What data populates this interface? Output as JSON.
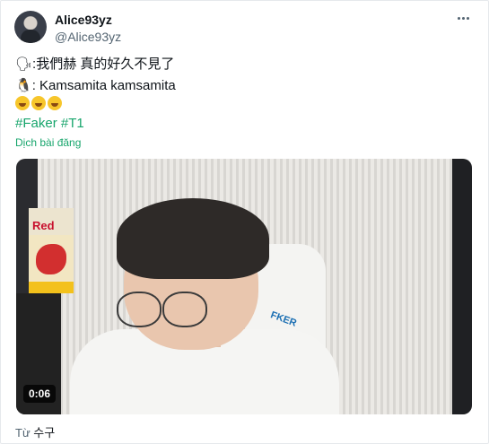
{
  "author": {
    "name": "Alice93yz",
    "handle": "@Alice93yz"
  },
  "tweet": {
    "line1": ":我們赫 真的好久不見了",
    "line1_emoji": "🗣",
    "line2": ": Kamsamita kamsamita",
    "line2_emoji": "🐧",
    "hashtags": "#Faker #T1",
    "translate_label": "Dịch bài đăng"
  },
  "video": {
    "duration": "0:06",
    "wall_text": "Red",
    "chair_logo": "FKER"
  },
  "source": {
    "prefix": "Từ",
    "name": "수구"
  }
}
